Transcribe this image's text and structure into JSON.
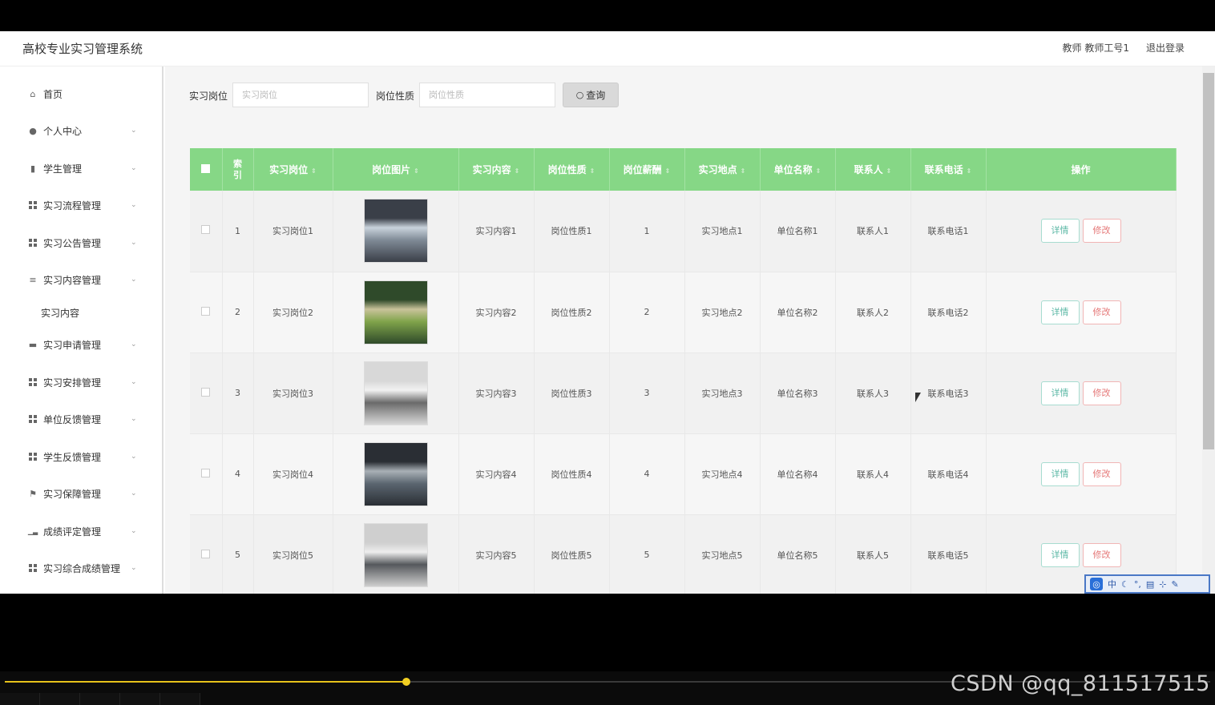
{
  "header": {
    "app_title": "高校专业实习管理系统",
    "user_info": "教师 教师工号1",
    "logout_label": "退出登录"
  },
  "sidebar": {
    "items": [
      {
        "label": "首页",
        "icon": "home-icon"
      },
      {
        "label": "个人中心",
        "icon": "user-icon"
      },
      {
        "label": "学生管理",
        "icon": "chart-icon"
      },
      {
        "label": "实习流程管理",
        "icon": "grid-icon"
      },
      {
        "label": "实习公告管理",
        "icon": "grid-icon"
      },
      {
        "label": "实习内容管理",
        "icon": "menu-icon"
      },
      {
        "label": "实习申请管理",
        "icon": "monitor-icon"
      },
      {
        "label": "实习安排管理",
        "icon": "grid-icon"
      },
      {
        "label": "单位反馈管理",
        "icon": "grid-icon"
      },
      {
        "label": "学生反馈管理",
        "icon": "grid-icon"
      },
      {
        "label": "实习保障管理",
        "icon": "flag-icon"
      },
      {
        "label": "成绩评定管理",
        "icon": "bar-chart-icon"
      },
      {
        "label": "实习综合成绩管理",
        "icon": "grid-icon"
      }
    ],
    "sub_item": "实习内容"
  },
  "search": {
    "field1_label": "实习岗位",
    "field1_placeholder": "实习岗位",
    "field2_label": "岗位性质",
    "field2_placeholder": "岗位性质",
    "button_label": "查询"
  },
  "table": {
    "headers": [
      "索引",
      "实习岗位",
      "岗位图片",
      "实习内容",
      "岗位性质",
      "岗位薪酬",
      "实习地点",
      "单位名称",
      "联系人",
      "联系电话",
      "操作"
    ],
    "rows": [
      {
        "index": "1",
        "post": "实习岗位1",
        "content": "实习内容1",
        "nature": "岗位性质1",
        "salary": "1",
        "place": "实习地点1",
        "unit": "单位名称1",
        "contact": "联系人1",
        "phone": "联系电话1"
      },
      {
        "index": "2",
        "post": "实习岗位2",
        "content": "实习内容2",
        "nature": "岗位性质2",
        "salary": "2",
        "place": "实习地点2",
        "unit": "单位名称2",
        "contact": "联系人2",
        "phone": "联系电话2"
      },
      {
        "index": "3",
        "post": "实习岗位3",
        "content": "实习内容3",
        "nature": "岗位性质3",
        "salary": "3",
        "place": "实习地点3",
        "unit": "单位名称3",
        "contact": "联系人3",
        "phone": "联系电话3"
      },
      {
        "index": "4",
        "post": "实习岗位4",
        "content": "实习内容4",
        "nature": "岗位性质4",
        "salary": "4",
        "place": "实习地点4",
        "unit": "单位名称4",
        "contact": "联系人4",
        "phone": "联系电话4"
      },
      {
        "index": "5",
        "post": "实习岗位5",
        "content": "实习内容5",
        "nature": "岗位性质5",
        "salary": "5",
        "place": "实习地点5",
        "unit": "单位名称5",
        "contact": "联系人5",
        "phone": "联系电话5"
      }
    ],
    "detail_label": "详情",
    "edit_label": "修改"
  },
  "ime_toolbar": {
    "lang": "中"
  },
  "video_player": {
    "progress": 0.333
  },
  "watermark": "CSDN @qq_811517515",
  "colors": {
    "header_green": "#86d786",
    "detail": "#5cb8a6",
    "edit": "#e57878",
    "progress": "#e7c21a"
  }
}
